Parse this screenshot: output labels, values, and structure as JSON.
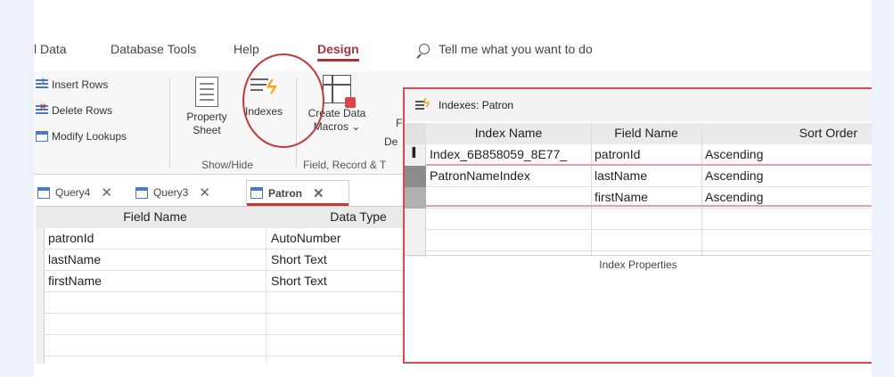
{
  "ribbon_tabs": {
    "external_data": "l Data",
    "database_tools": "Database Tools",
    "help": "Help",
    "design": "Design",
    "tell_me": "Tell me what you want to do"
  },
  "ribbon": {
    "insert_rows": "Insert Rows",
    "delete_rows": "Delete Rows",
    "modify_lookups": "Modify Lookups",
    "property_sheet_line1": "Property",
    "property_sheet_line2": "Sheet",
    "indexes": "Indexes",
    "create_data_macros_line1": "Create Data",
    "create_data_macros_line2": "Macros ⌄",
    "delete_partial": "De",
    "partial_f": "F",
    "group_show_hide": "Show/Hide",
    "group_field_record": "Field, Record & T"
  },
  "document_tabs": [
    {
      "label": "Query4"
    },
    {
      "label": "Query3"
    },
    {
      "label": "Patron"
    }
  ],
  "design_grid": {
    "headers": {
      "field_name": "Field Name",
      "data_type": "Data Type"
    },
    "rows": [
      {
        "field_name": "patronId",
        "data_type": "AutoNumber"
      },
      {
        "field_name": "lastName",
        "data_type": "Short Text"
      },
      {
        "field_name": "firstName",
        "data_type": "Short Text"
      }
    ]
  },
  "indexes_dialog": {
    "title": "Indexes: Patron",
    "headers": {
      "index_name": "Index Name",
      "field_name": "Field Name",
      "sort_order": "Sort Order"
    },
    "rows": [
      {
        "index_name": "Index_6B858059_8E77_",
        "field_name": "patronId",
        "sort_order": "Ascending"
      },
      {
        "index_name": "PatronNameIndex",
        "field_name": "lastName",
        "sort_order": "Ascending"
      },
      {
        "index_name": "",
        "field_name": "firstName",
        "sort_order": "Ascending"
      }
    ],
    "properties_label": "Index Properties"
  },
  "colors": {
    "accent": "#a4373a",
    "annotation": "#c0393b",
    "dialog_border": "#d24b55"
  }
}
